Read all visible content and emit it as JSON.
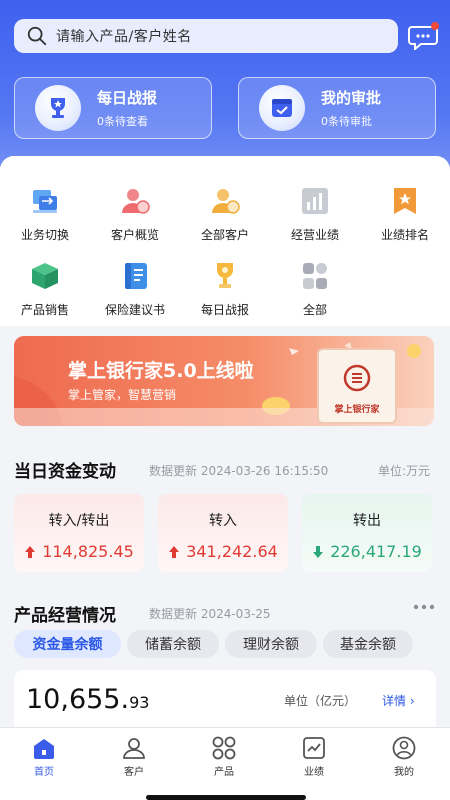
{
  "search": {
    "placeholder": "请输入产品/客户姓名"
  },
  "cards": [
    {
      "title": "每日战报",
      "sub": "0条待查看"
    },
    {
      "title": "我的审批",
      "sub": "0条待审批"
    }
  ],
  "grid": [
    {
      "label": "业务切换",
      "icon": "business-switch-icon"
    },
    {
      "label": "客户概览",
      "icon": "customer-overview-icon"
    },
    {
      "label": "全部客户",
      "icon": "all-customers-icon"
    },
    {
      "label": "经营业绩",
      "icon": "business-performance-icon"
    },
    {
      "label": "业绩排名",
      "icon": "ranking-icon"
    },
    {
      "label": "产品销售",
      "icon": "product-sales-icon"
    },
    {
      "label": "保险建议书",
      "icon": "insurance-proposal-icon"
    },
    {
      "label": "每日战报",
      "icon": "daily-report-icon"
    },
    {
      "label": "全部",
      "icon": "all-apps-icon"
    }
  ],
  "banner": {
    "title": "掌上银行家5.0上线啦",
    "subtitle": "掌上管家，智慧营销",
    "book_text": "掌上银行家"
  },
  "funds": {
    "title": "当日资金变动",
    "meta": "数据更新 2024-03-26 16:15:50",
    "unit": "单位:万元",
    "items": [
      {
        "label": "转入/转出",
        "value": "114,825.45",
        "dir": "up"
      },
      {
        "label": "转入",
        "value": "341,242.64",
        "dir": "up"
      },
      {
        "label": "转出",
        "value": "226,417.19",
        "dir": "down"
      }
    ]
  },
  "products": {
    "title": "产品经营情况",
    "meta": "数据更新 2024-03-25",
    "tabs": [
      "资金量余额",
      "储蓄余额",
      "理财余额",
      "基金余额"
    ],
    "big_int": "10,655.",
    "big_dec": "93",
    "unit": "单位（亿元）",
    "detail": "详情 ›"
  },
  "tabbar": [
    {
      "label": "首页",
      "active": true
    },
    {
      "label": "客户",
      "active": false
    },
    {
      "label": "产品",
      "active": false
    },
    {
      "label": "业绩",
      "active": false
    },
    {
      "label": "我的",
      "active": false
    }
  ],
  "colors": {
    "primary": "#3f60ee",
    "up": "#e03b32",
    "down": "#2aa77b"
  }
}
